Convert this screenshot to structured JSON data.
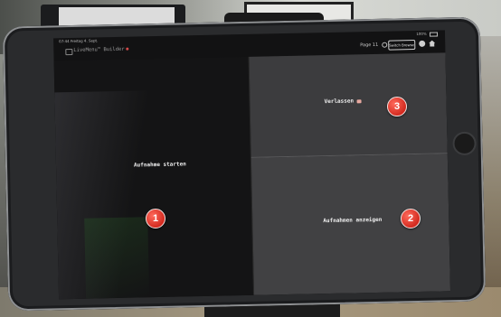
{
  "status_bar": {
    "time_date": "07:44  Freitag 4. Sept.",
    "battery": "100%"
  },
  "header": {
    "app_title": "LiveMenu™ Builder",
    "page_indicator": "Page 11",
    "browse_button_label": "Switch Browse Page"
  },
  "tiles": {
    "left": {
      "label": "Aufnahme starten"
    },
    "top_right": {
      "label": "Verlassen"
    },
    "bottom_right": {
      "label": "Aufnahmen anzeigen"
    }
  },
  "markers": [
    "1",
    "2",
    "3"
  ],
  "colors": {
    "marker_red": "#d32a1f",
    "screen_dark": "#141415",
    "tile_grey": "#3c3c3e"
  }
}
